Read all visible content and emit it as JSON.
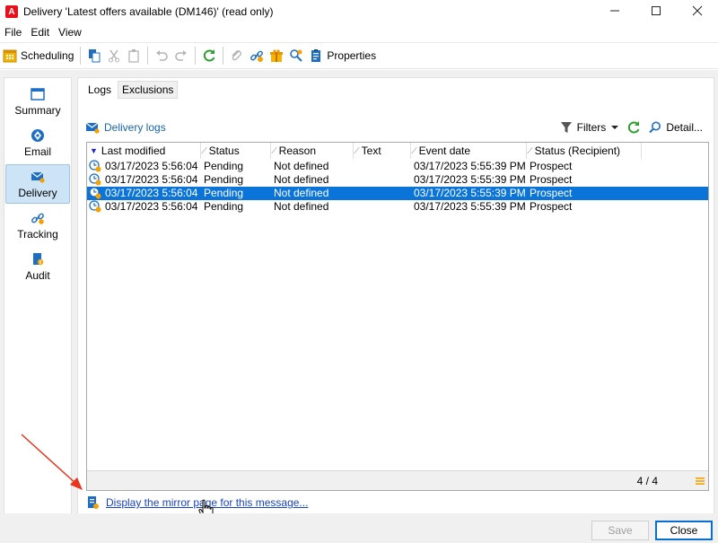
{
  "window": {
    "title": "Delivery 'Latest offers available (DM146)' (read only)",
    "logo_letter": "A",
    "accent": "#e8101a",
    "controls": [
      "minimize-icon",
      "maximize-icon",
      "close-icon"
    ]
  },
  "menubar": {
    "items": [
      "File",
      "Edit",
      "View"
    ]
  },
  "toolbar": {
    "scheduling_label": "Scheduling",
    "properties_label": "Properties"
  },
  "sidenav": {
    "items": [
      {
        "label": "Summary",
        "icon": "summary-icon",
        "active": false
      },
      {
        "label": "Email",
        "icon": "email-icon",
        "active": false
      },
      {
        "label": "Delivery",
        "icon": "delivery-icon",
        "active": true
      },
      {
        "label": "Tracking",
        "icon": "tracking-icon",
        "active": false
      },
      {
        "label": "Audit",
        "icon": "audit-icon",
        "active": false
      }
    ]
  },
  "tabs": {
    "items": [
      "Logs",
      "Exclusions"
    ],
    "active": "Logs"
  },
  "logs_toolbar": {
    "title": "Delivery logs",
    "filters_label": "Filters",
    "detail_label": "Detail..."
  },
  "grid": {
    "columns": [
      "Last modified",
      "Status",
      "Reason",
      "Text",
      "Event date",
      "Status (Recipient)"
    ],
    "sort_column": "Last modified",
    "rows": [
      {
        "last_modified": "03/17/2023 5:56:04 ...",
        "status": "Pending",
        "reason": "Not defined",
        "text": "",
        "event_date": "03/17/2023 5:55:39 PM",
        "recipient_status": "Prospect",
        "selected": false
      },
      {
        "last_modified": "03/17/2023 5:56:04 ...",
        "status": "Pending",
        "reason": "Not defined",
        "text": "",
        "event_date": "03/17/2023 5:55:39 PM",
        "recipient_status": "Prospect",
        "selected": false
      },
      {
        "last_modified": "03/17/2023 5:56:04 ...",
        "status": "Pending",
        "reason": "Not defined",
        "text": "",
        "event_date": "03/17/2023 5:55:39 PM",
        "recipient_status": "Prospect",
        "selected": true
      },
      {
        "last_modified": "03/17/2023 5:56:04 ...",
        "status": "Pending",
        "reason": "Not defined",
        "text": "",
        "event_date": "03/17/2023 5:55:39 PM",
        "recipient_status": "Prospect",
        "selected": false
      }
    ],
    "count": "4 / 4"
  },
  "mirror_link": "Display the mirror page for this message...",
  "buttons": {
    "save": "Save",
    "close": "Close"
  },
  "colors": {
    "selection": "#0b74d8",
    "link": "#1a43c4",
    "annotation": "#e8341c"
  }
}
